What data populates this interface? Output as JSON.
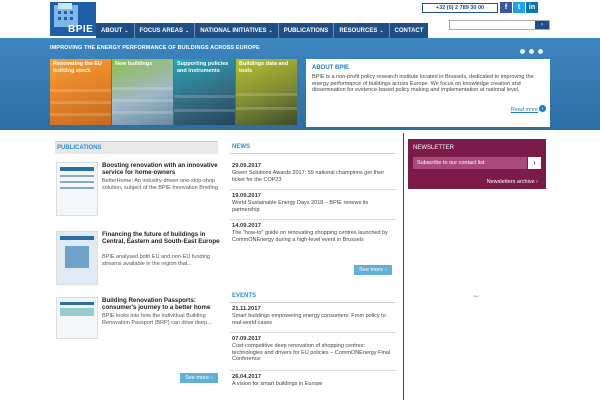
{
  "header": {
    "logo_text": "BPIE",
    "phone": "+32 (0) 2 789 30 00",
    "social": [
      "f",
      "t",
      "in"
    ],
    "search_placeholder": "",
    "search_button": "›"
  },
  "nav": [
    {
      "label": "ABOUT",
      "dropdown": true
    },
    {
      "label": "FOCUS AREAS",
      "dropdown": true
    },
    {
      "label": "NATIONAL INITIATIVES",
      "dropdown": true
    },
    {
      "label": "PUBLICATIONS",
      "dropdown": false
    },
    {
      "label": "RESOURCES",
      "dropdown": true
    },
    {
      "label": "CONTACT",
      "dropdown": false
    }
  ],
  "hero": {
    "tagline": "IMPROVING THE ENERGY PERFORMANCE OF BUILDINGS ACROSS EUROPE",
    "tiles": [
      "Renovating the EU building stock",
      "New buildings",
      "Supporting policies and instruments",
      "Buildings data and tools"
    ],
    "about": {
      "heading": "ABOUT BPIE",
      "body": "BPIE is a non-profit policy research institute located in Brussels, dedicated to improving the energy performance of buildings across Europe. We focus on knowledge creation and dissemination for evidence-based policy making and implementation at national level.",
      "more": "Read more"
    }
  },
  "publications": {
    "heading": "PUBLICATIONS",
    "items": [
      {
        "title": "Boosting renovation with an innovative service for home-owners",
        "desc": "BetterHome: An industry-driven one-stop-shop solution, subject of the BPIE Innovation Briefing"
      },
      {
        "title": "Financing the future of buildings in Central, Eastern and South-East Europe",
        "desc": "BPIE analysed both EU and non-EU funding streams available in the region that..."
      },
      {
        "title": "Building Renovation Passports: consumer's journey to a better home",
        "desc": "BPIE looks into how the individual Building Renovation Passport (BRP) can drive deep..."
      }
    ],
    "see_more": "See more"
  },
  "news": {
    "heading": "NEWS",
    "items": [
      {
        "date": "29.09.2017",
        "text": "Green Solutions Awards 2017: 59 national champions get their ticket for the COP23"
      },
      {
        "date": "19.09.2017",
        "text": "World Sustainable Energy Days 2018 – BPIE renews its partnership"
      },
      {
        "date": "14.09.2017",
        "text": "The \"how-to\" guide on renovating shopping centres launched by CommONEnergy during a high-level event in Brussels"
      }
    ],
    "see_more": "See more"
  },
  "events": {
    "heading": "EVENTS",
    "items": [
      {
        "date": "21.11.2017",
        "text": "Smart buildings empowering energy consumers: From policy to real-world cases"
      },
      {
        "date": "07.09.2017",
        "text": "Cost-competitive deep renovation of shopping centres: technologies and drivers for EU policies – CommONEnergy Final Conference"
      },
      {
        "date": "26.04.2017",
        "text": "A vision for smart buildings in Europe"
      }
    ]
  },
  "newsletter": {
    "heading": "NEWSLETTER",
    "placeholder": "Subscribe to our contact list",
    "archive": "Newsletters archive ›"
  }
}
